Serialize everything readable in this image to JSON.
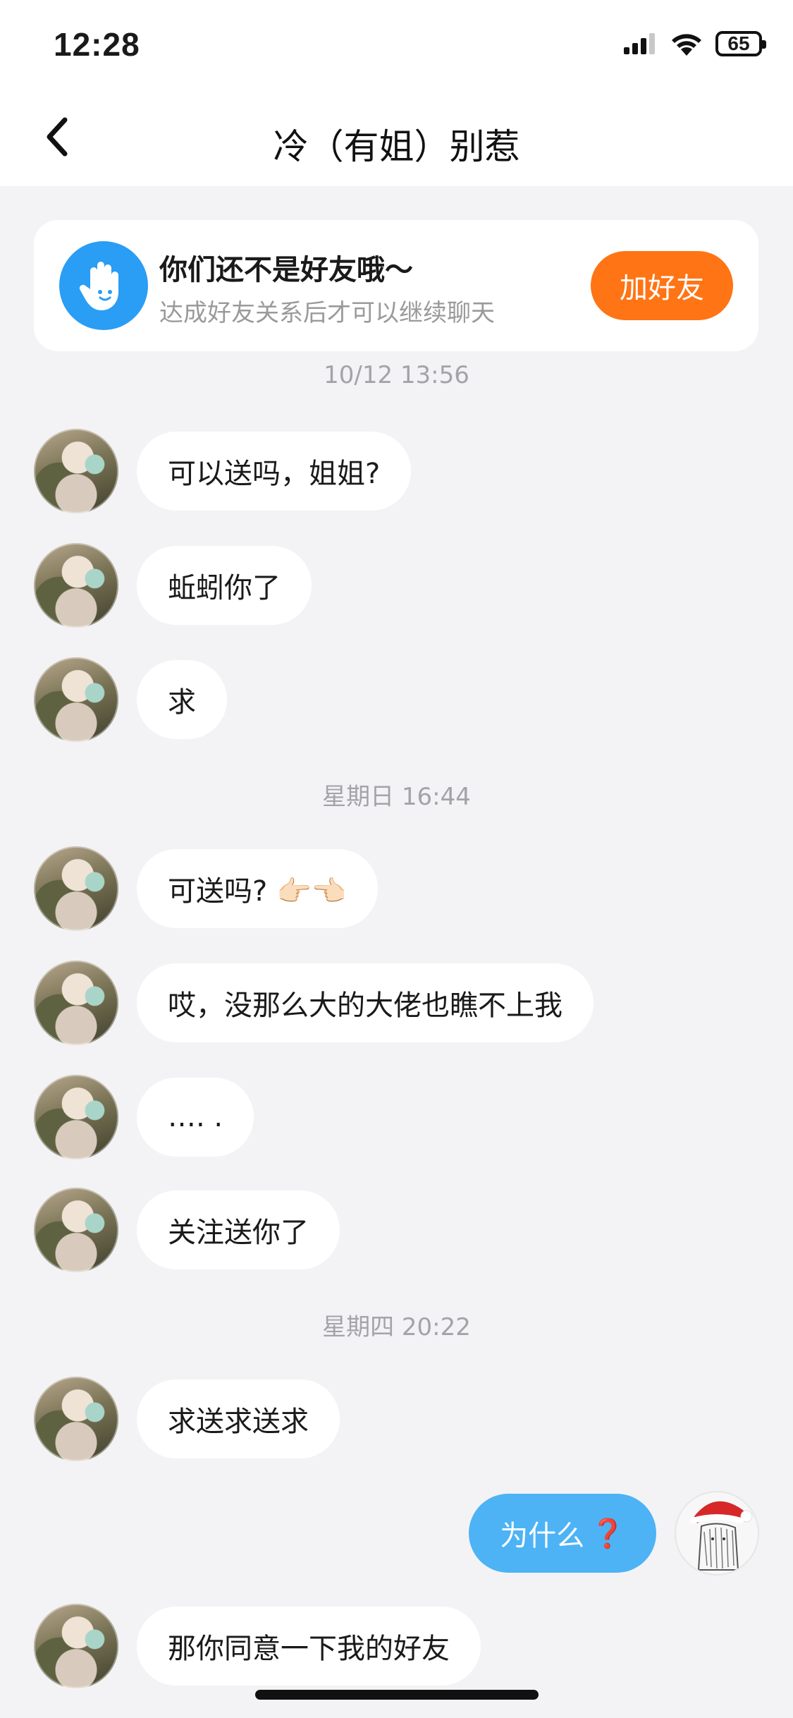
{
  "status": {
    "time": "12:28",
    "battery": "65"
  },
  "nav": {
    "title": "冷（有姐）别惹"
  },
  "friend_banner": {
    "title": "你们还不是好友哦～",
    "subtitle": "达成好友关系后才可以继续聊天",
    "button": "加好友"
  },
  "chat": {
    "separators": [
      "10/12 13:56",
      "星期日 16:44",
      "星期四 20:22"
    ],
    "messages": [
      {
        "text": "可以送吗，姐姐?"
      },
      {
        "text": "蚯蚓你了"
      },
      {
        "text": "求"
      },
      {
        "text": "可送吗? 👉🏻👈🏻"
      },
      {
        "text": "哎，没那么大的大佬也瞧不上我"
      },
      {
        "text": "….  ."
      },
      {
        "text": "关注送你了"
      },
      {
        "text": "求送求送求"
      },
      {
        "text": "为什么",
        "emoji": "❓"
      },
      {
        "text": "那你同意一下我的好友"
      }
    ]
  },
  "colors": {
    "accent_orange": "#ff7414",
    "my_bubble": "#4db3f5",
    "icon_blue": "#2a9df4"
  }
}
